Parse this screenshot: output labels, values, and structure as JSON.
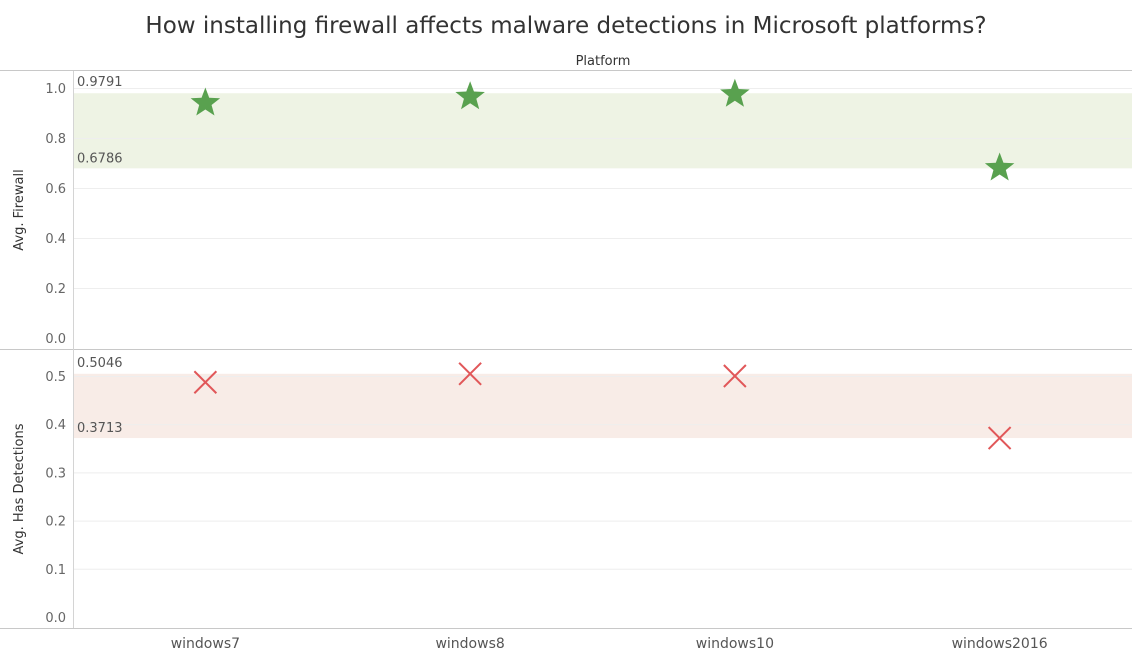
{
  "chart_data": {
    "type": "scatter",
    "title": "How installing firewall affects malware detections in Microsoft platforms?",
    "column_header": "Platform",
    "categories": [
      "windows7",
      "windows8",
      "windows10",
      "windows2016"
    ],
    "panels": [
      {
        "ylabel": "Avg. Firewall",
        "ylim": [
          0,
          1.05
        ],
        "ticks": [
          "0.0",
          "0.2",
          "0.4",
          "0.6",
          "0.8",
          "1.0"
        ],
        "tick_values": [
          0,
          0.2,
          0.4,
          0.6,
          0.8,
          1.0
        ],
        "values": [
          0.94,
          0.965,
          0.975,
          0.68
        ],
        "marker": "star",
        "marker_color": "#59a14f",
        "band": {
          "low": 0.6786,
          "high": 0.9791,
          "low_label": "0.6786",
          "high_label": "0.9791",
          "color": "#eef3e4"
        }
      },
      {
        "ylabel": "Avg. Has Detections",
        "ylim": [
          0,
          0.54
        ],
        "ticks": [
          "0.0",
          "0.1",
          "0.2",
          "0.3",
          "0.4",
          "0.5"
        ],
        "tick_values": [
          0,
          0.1,
          0.2,
          0.3,
          0.4,
          0.5
        ],
        "values": [
          0.487,
          0.5046,
          0.5,
          0.3713
        ],
        "marker": "x",
        "marker_color": "#e15759",
        "band": {
          "low": 0.3713,
          "high": 0.5046,
          "low_label": "0.3713",
          "high_label": "0.5046",
          "color": "#f8ece7"
        }
      }
    ],
    "grid": true
  }
}
